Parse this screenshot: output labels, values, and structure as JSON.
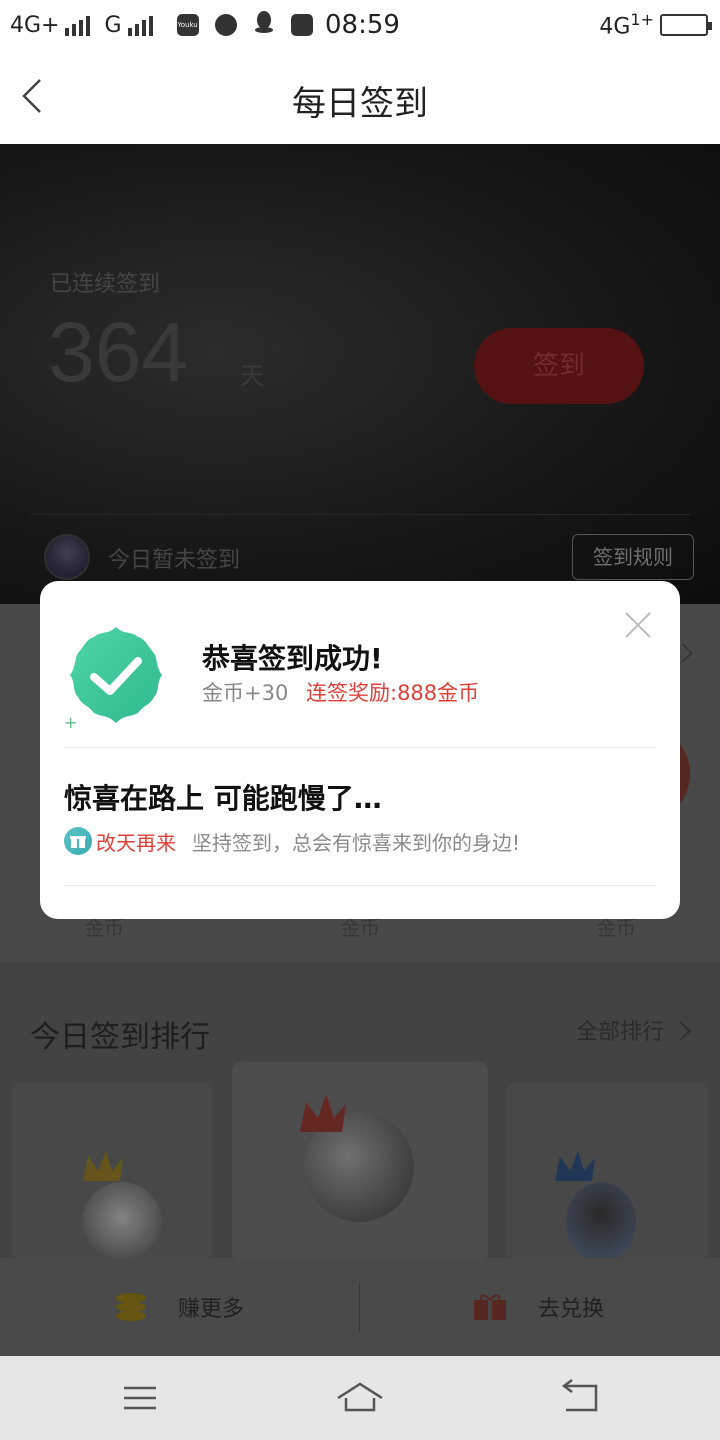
{
  "statusbar": {
    "network1": "4G+",
    "network2": "G",
    "app_icon_youku": "Youku",
    "time": "08:59",
    "network_right": "4G",
    "network_right_super": "1+"
  },
  "navbar": {
    "title": "每日签到",
    "back_icon": "chevron-left-icon"
  },
  "hero": {
    "streak_label": "已连续签到",
    "streak_days": "364",
    "streak_unit": "天",
    "checkin_button": "签到",
    "today_status": "今日暂未签到",
    "rules_button": "签到规则"
  },
  "rewards": {
    "coin_labels": [
      "金币",
      "金币",
      "金币"
    ]
  },
  "ranking": {
    "title": "今日签到排行",
    "all_link": "全部排行"
  },
  "actions": {
    "earn_more": "赚更多",
    "redeem": "去兑换",
    "earn_icon": "coin-stack-icon",
    "redeem_icon": "gift-icon"
  },
  "modal": {
    "title": "恭喜签到成功!",
    "coins": "金币+30",
    "streak_bonus": "连签奖励:888金币",
    "plus_mark": "+",
    "subtitle": "惊喜在路上 可能跑慢了…",
    "again": "改天再来",
    "hint": "坚持签到，总会有惊喜来到你的身边!",
    "accent": "#e0403a",
    "badge_color": "#3cc79a"
  },
  "sysnav": {
    "menu_icon": "menu-icon",
    "home_icon": "home-icon",
    "back_icon": "return-icon"
  }
}
